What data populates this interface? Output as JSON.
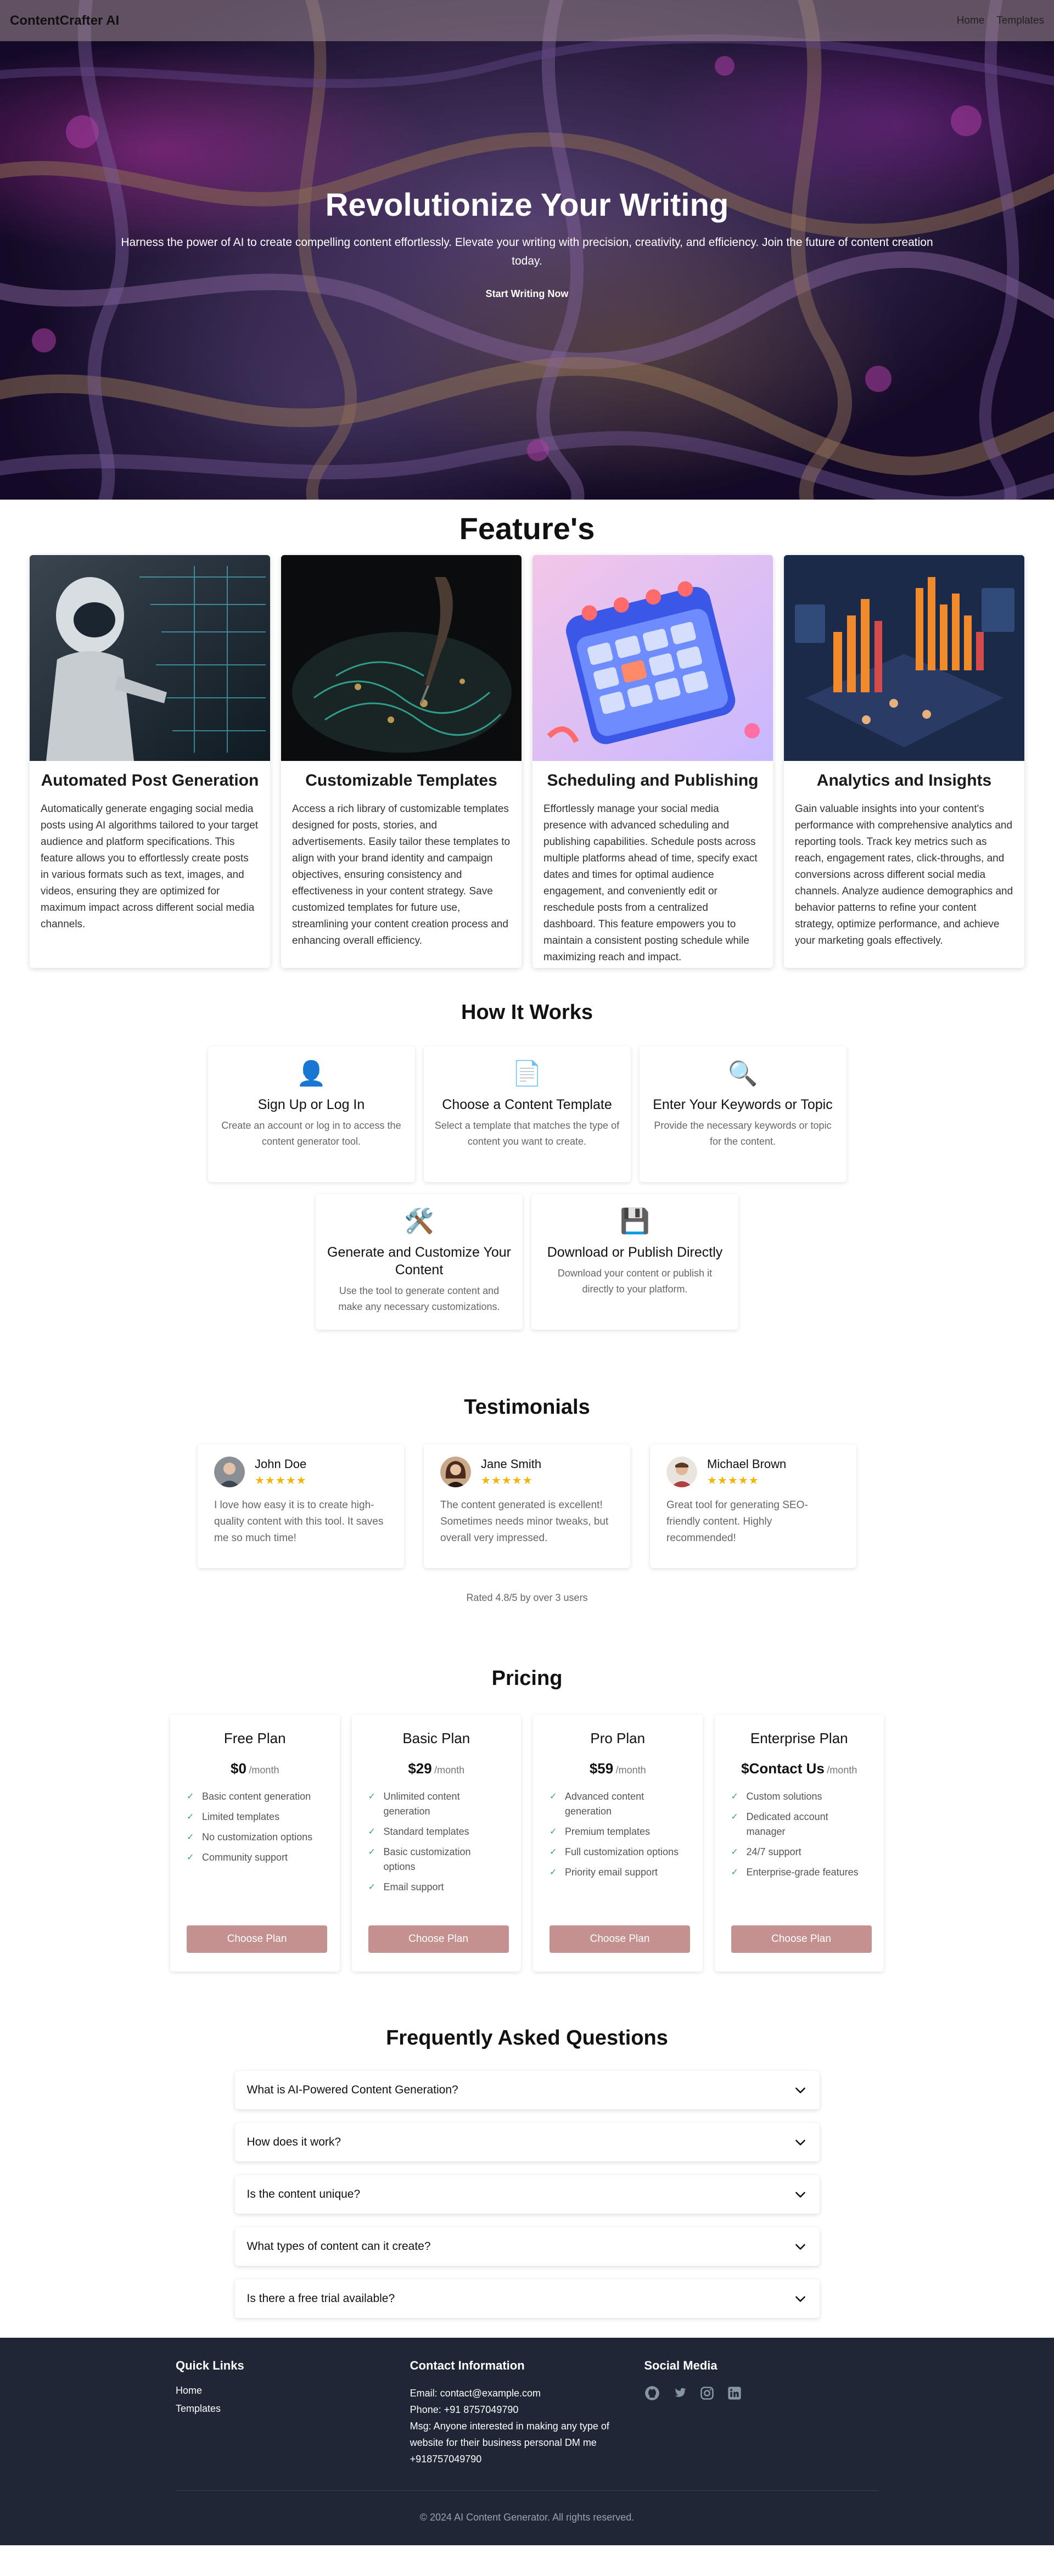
{
  "nav": {
    "brand": "ContentCrafter AI",
    "links": [
      "Home",
      "Templates"
    ]
  },
  "hero": {
    "title": "Revolutionize Your Writing",
    "subtitle": "Harness the power of AI to create compelling content effortlessly. Elevate your writing with precision, creativity, and efficiency. Join the future of content creation today.",
    "cta": "Start Writing Now"
  },
  "features": {
    "title": "Feature's",
    "items": [
      {
        "title": "Automated Post Generation",
        "text": "Automatically generate engaging social media posts using AI algorithms tailored to your target audience and platform specifications. This feature allows you to effortlessly create posts in various formats such as text, images, and videos, ensuring they are optimized for maximum impact across different social media channels."
      },
      {
        "title": "Customizable Templates",
        "text": "Access a rich library of customizable templates designed for posts, stories, and advertisements. Easily tailor these templates to align with your brand identity and campaign objectives, ensuring consistency and effectiveness in your content strategy. Save customized templates for future use, streamlining your content creation process and enhancing overall efficiency."
      },
      {
        "title": "Scheduling and Publishing",
        "text": "Effortlessly manage your social media presence with advanced scheduling and publishing capabilities. Schedule posts across multiple platforms ahead of time, specify exact dates and times for optimal audience engagement, and conveniently edit or reschedule posts from a centralized dashboard. This feature empowers you to maintain a consistent posting schedule while maximizing reach and impact."
      },
      {
        "title": "Analytics and Insights",
        "text": "Gain valuable insights into your content's performance with comprehensive analytics and reporting tools. Track key metrics such as reach, engagement rates, click-throughs, and conversions across different social media channels. Analyze audience demographics and behavior patterns to refine your content strategy, optimize performance, and achieve your marketing goals effectively."
      }
    ]
  },
  "how": {
    "title": "How It Works",
    "steps": [
      {
        "icon": "👤",
        "title": "Sign Up or Log In",
        "text": "Create an account or log in to access the content generator tool."
      },
      {
        "icon": "📄",
        "title": "Choose a Content Template",
        "text": "Select a template that matches the type of content you want to create."
      },
      {
        "icon": "🔍",
        "title": "Enter Your Keywords or Topic",
        "text": "Provide the necessary keywords or topic for the content."
      },
      {
        "icon": "🛠️",
        "title": "Generate and Customize Your Content",
        "text": "Use the tool to generate content and make any necessary customizations."
      },
      {
        "icon": "💾",
        "title": "Download or Publish Directly",
        "text": "Download your content or publish it directly to your platform."
      }
    ]
  },
  "testimonials": {
    "title": "Testimonials",
    "items": [
      {
        "name": "John Doe",
        "stars": "★★★★★",
        "text": "I love how easy it is to create high-quality content with this tool. It saves me so much time!"
      },
      {
        "name": "Jane Smith",
        "stars": "★★★★★",
        "text": "The content generated is excellent! Sometimes needs minor tweaks, but overall very impressed."
      },
      {
        "name": "Michael Brown",
        "stars": "★★★★★",
        "text": "Great tool for generating SEO-friendly content. Highly recommended!"
      }
    ],
    "rated": "Rated 4.8/5 by over 3 users"
  },
  "pricing": {
    "title": "Pricing",
    "per": "/month",
    "button": "Choose Plan",
    "plans": [
      {
        "name": "Free Plan",
        "price": "$0",
        "features": [
          "Basic content generation",
          "Limited templates",
          "No customization options",
          "Community support"
        ]
      },
      {
        "name": "Basic Plan",
        "price": "$29",
        "features": [
          "Unlimited content generation",
          "Standard templates",
          "Basic customization options",
          "Email support"
        ]
      },
      {
        "name": "Pro Plan",
        "price": "$59",
        "features": [
          "Advanced content generation",
          "Premium templates",
          "Full customization options",
          "Priority email support"
        ]
      },
      {
        "name": "Enterprise Plan",
        "price": "$Contact Us",
        "features": [
          "Custom solutions",
          "Dedicated account manager",
          "24/7 support",
          "Enterprise-grade features"
        ]
      }
    ]
  },
  "faq": {
    "title": "Frequently Asked Questions",
    "items": [
      "What is AI-Powered Content Generation?",
      "How does it work?",
      "Is the content unique?",
      "What types of content can it create?",
      "Is there a free trial available?"
    ]
  },
  "footer": {
    "quick_links_title": "Quick Links",
    "quick_links": [
      "Home",
      "Templates"
    ],
    "contact_title": "Contact Information",
    "email": "Email: contact@example.com",
    "phone": "Phone: +91 8757049790",
    "msg": "Msg: Anyone interested in making any type of website for their business personal DM me +918757049790",
    "social_title": "Social Media",
    "social_icons": [
      "github-icon",
      "twitter-icon",
      "instagram-icon",
      "linkedin-icon"
    ],
    "copyright": "© 2024 AI Content Generator. All rights reserved."
  },
  "colors": {
    "accent_button": "#c49090",
    "footer_bg": "#1f2736",
    "star": "#f5b400",
    "check": "#3aa36b"
  }
}
